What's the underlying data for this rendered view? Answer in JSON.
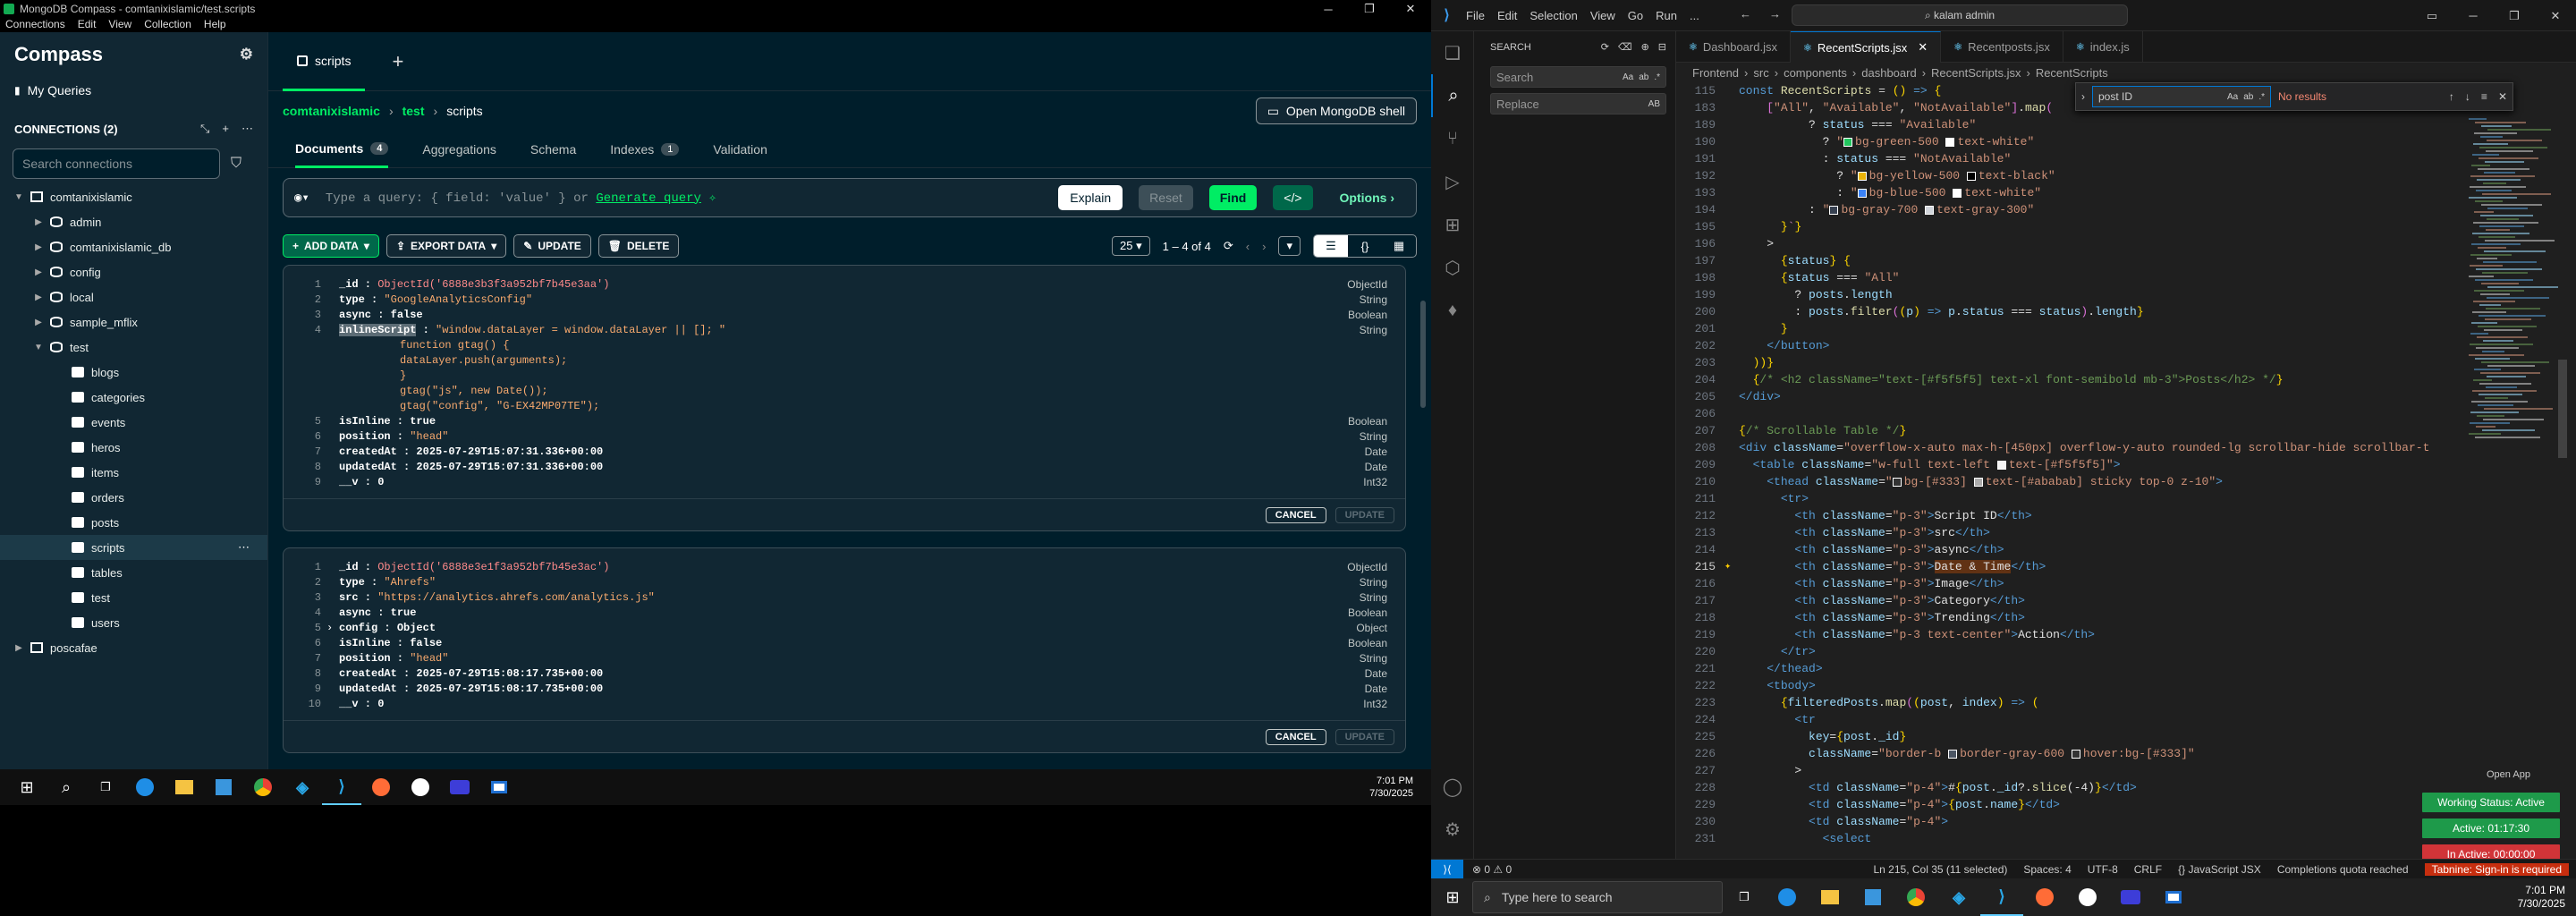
{
  "compass": {
    "window_title": "MongoDB Compass - comtanixislamic/test.scripts",
    "menu": [
      "Connections",
      "Edit",
      "View",
      "Collection",
      "Help"
    ],
    "brand": "Compass",
    "my_queries": "My Queries",
    "connections_header": "CONNECTIONS (2)",
    "search_placeholder": "Search connections",
    "tree": [
      {
        "label": "comtanixislamic",
        "level": 0,
        "type": "server",
        "open": true
      },
      {
        "label": "admin",
        "level": 1,
        "type": "db"
      },
      {
        "label": "comtanixislamic_db",
        "level": 1,
        "type": "db"
      },
      {
        "label": "config",
        "level": 1,
        "type": "db"
      },
      {
        "label": "local",
        "level": 1,
        "type": "db"
      },
      {
        "label": "sample_mflix",
        "level": 1,
        "type": "db"
      },
      {
        "label": "test",
        "level": 1,
        "type": "db",
        "open": true
      },
      {
        "label": "blogs",
        "level": 2,
        "type": "coll"
      },
      {
        "label": "categories",
        "level": 2,
        "type": "coll"
      },
      {
        "label": "events",
        "level": 2,
        "type": "coll"
      },
      {
        "label": "heros",
        "level": 2,
        "type": "coll"
      },
      {
        "label": "items",
        "level": 2,
        "type": "coll"
      },
      {
        "label": "orders",
        "level": 2,
        "type": "coll"
      },
      {
        "label": "posts",
        "level": 2,
        "type": "coll"
      },
      {
        "label": "scripts",
        "level": 2,
        "type": "coll",
        "active": true
      },
      {
        "label": "tables",
        "level": 2,
        "type": "coll"
      },
      {
        "label": "test",
        "level": 2,
        "type": "coll"
      },
      {
        "label": "users",
        "level": 2,
        "type": "coll"
      },
      {
        "label": "poscafae",
        "level": 0,
        "type": "server"
      }
    ],
    "tab_label": "scripts",
    "breadcrumb": {
      "server": "comtanixislamic",
      "db": "test",
      "coll": "scripts"
    },
    "shell_btn": "Open MongoDB shell",
    "subtabs": [
      {
        "label": "Documents",
        "badge": "4",
        "on": true
      },
      {
        "label": "Aggregations"
      },
      {
        "label": "Schema"
      },
      {
        "label": "Indexes",
        "badge": "1"
      },
      {
        "label": "Validation"
      }
    ],
    "query": {
      "placeholder": "Type a query: { field: 'value' } or",
      "gen": "Generate query",
      "explain": "Explain",
      "reset": "Reset",
      "find": "Find",
      "options": "Options"
    },
    "actions": {
      "add": "ADD DATA",
      "export": "EXPORT DATA",
      "update": "UPDATE",
      "delete": "DELETE"
    },
    "pager": {
      "size": "25",
      "range": "1 – 4 of 4"
    },
    "docs": [
      {
        "lines": [
          {
            "n": "1",
            "k": "_id",
            "v": "ObjectId('6888e3b3f3a952bf7b45e3aa')",
            "c": "oid",
            "t": "ObjectId"
          },
          {
            "n": "2",
            "k": "type",
            "v": "\"GoogleAnalyticsConfig\"",
            "c": "str",
            "t": "String"
          },
          {
            "n": "3",
            "k": "async",
            "v": "false",
            "c": "kw",
            "t": "Boolean"
          },
          {
            "n": "4",
            "k": "inlineScript",
            "v": "\"window.dataLayer = window.dataLayer || []; \"",
            "c": "str",
            "t": "String",
            "sel": true
          },
          {
            "n": "",
            "k": "",
            "v": "function gtag() {",
            "c": "str",
            "t": "",
            "ind": true
          },
          {
            "n": "",
            "k": "",
            "v": "  dataLayer.push(arguments);",
            "c": "str",
            "t": "",
            "ind": true
          },
          {
            "n": "",
            "k": "",
            "v": "}",
            "c": "str",
            "t": "",
            "ind": true
          },
          {
            "n": "",
            "k": "",
            "v": "gtag(\"js\", new Date());",
            "c": "str",
            "t": "",
            "ind": true
          },
          {
            "n": "",
            "k": "",
            "v": "gtag(\"config\", \"G-EX42MP07TE\");",
            "c": "str",
            "t": "",
            "ind": true
          },
          {
            "n": "5",
            "k": "isInline",
            "v": "true",
            "c": "kw",
            "t": "Boolean"
          },
          {
            "n": "6",
            "k": "position",
            "v": "\"head\"",
            "c": "str",
            "t": "String"
          },
          {
            "n": "7",
            "k": "createdAt",
            "v": "2025-07-29T15:07:31.336+00:00",
            "c": "kw",
            "t": "Date"
          },
          {
            "n": "8",
            "k": "updatedAt",
            "v": "2025-07-29T15:07:31.336+00:00",
            "c": "kw",
            "t": "Date"
          },
          {
            "n": "9",
            "k": "__v",
            "v": "0",
            "c": "kw",
            "t": "Int32"
          }
        ]
      },
      {
        "lines": [
          {
            "n": "1",
            "k": "_id",
            "v": "ObjectId('6888e3e1f3a952bf7b45e3ac')",
            "c": "oid",
            "t": "ObjectId"
          },
          {
            "n": "2",
            "k": "type",
            "v": "\"Ahrefs\"",
            "c": "str",
            "t": "String"
          },
          {
            "n": "3",
            "k": "src",
            "v": "\"https://analytics.ahrefs.com/analytics.js\"",
            "c": "str",
            "t": "String"
          },
          {
            "n": "4",
            "k": "async",
            "v": "true",
            "c": "kw",
            "t": "Boolean"
          },
          {
            "n": "5",
            "k": "config",
            "v": "Object",
            "c": "kw",
            "t": "Object",
            "arrow": true
          },
          {
            "n": "6",
            "k": "isInline",
            "v": "false",
            "c": "kw",
            "t": "Boolean"
          },
          {
            "n": "7",
            "k": "position",
            "v": "\"head\"",
            "c": "str",
            "t": "String"
          },
          {
            "n": "8",
            "k": "createdAt",
            "v": "2025-07-29T15:08:17.735+00:00",
            "c": "kw",
            "t": "Date"
          },
          {
            "n": "9",
            "k": "updatedAt",
            "v": "2025-07-29T15:08:17.735+00:00",
            "c": "kw",
            "t": "Date"
          },
          {
            "n": "10",
            "k": "__v",
            "v": "0",
            "c": "kw",
            "t": "Int32"
          }
        ]
      }
    ],
    "cancel": "CANCEL",
    "update_btn": "UPDATE",
    "clock": {
      "time": "7:01 PM",
      "date": "7/30/2025"
    }
  },
  "vscode": {
    "menu": [
      "File",
      "Edit",
      "Selection",
      "View",
      "Go",
      "Run",
      "..."
    ],
    "command_center": "kalam admin",
    "search_title": "SEARCH",
    "search_placeholder": "Search",
    "replace_placeholder": "Replace",
    "tabs": [
      {
        "label": "Dashboard.jsx",
        "on": false
      },
      {
        "label": "RecentScripts.jsx",
        "on": true
      },
      {
        "label": "Recentposts.jsx",
        "on": false
      },
      {
        "label": "index.js",
        "on": false
      }
    ],
    "breadcrumb": [
      "Frontend",
      "src",
      "components",
      "dashboard",
      "RecentScripts.jsx",
      "RecentScripts"
    ],
    "find": {
      "value": "post ID",
      "result": "No results"
    },
    "status": {
      "errors": "⊗ 0  ⚠ 0",
      "pos": "Ln 215, Col 35 (11 selected)",
      "spaces": "Spaces: 4",
      "enc": "UTF-8",
      "eol": "CRLF",
      "lang": "{} JavaScript JSX",
      "quota": "Completions quota reached",
      "tabnine": "Tabnine: Sign-in is required"
    },
    "working": {
      "status": "Working Status: Active",
      "active": "Active: 01:17:30",
      "inactive": "In Active: 00:00:00"
    },
    "open_app": "Open App",
    "taskbar_search": "Type here to search",
    "clock": {
      "time": "7:01 PM",
      "date": "7/30/2025"
    }
  }
}
